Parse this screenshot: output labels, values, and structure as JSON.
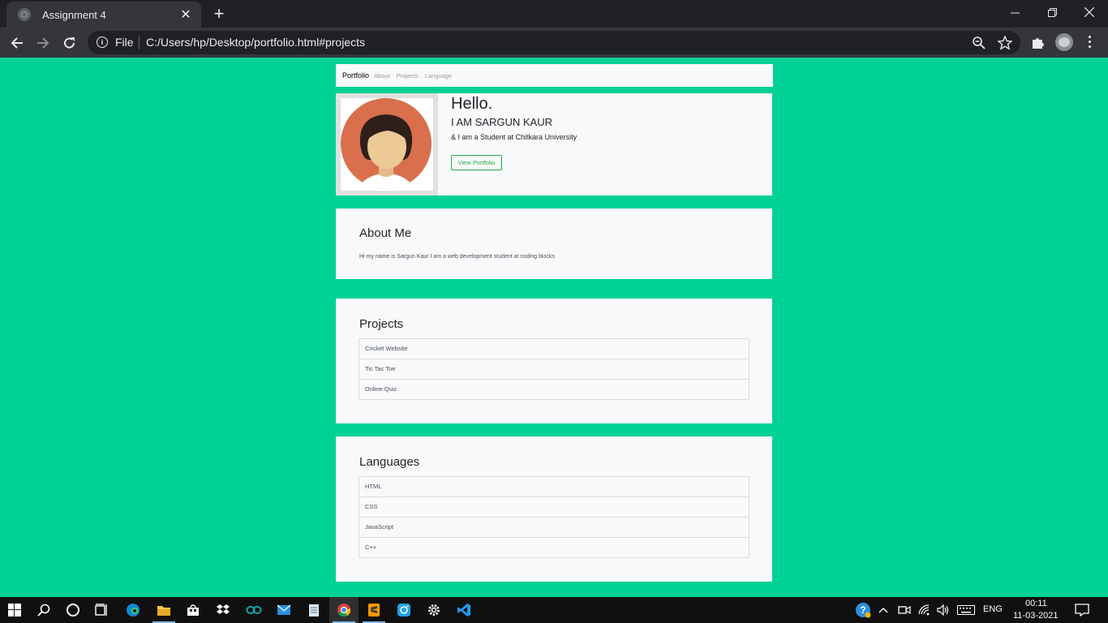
{
  "browser": {
    "tab_title": "Assignment 4",
    "tab_close": "✕",
    "new_tab": "+",
    "url_scheme": "File",
    "url": "C:/Users/hp/Desktop/portfolio.html#projects",
    "window_controls": {
      "minimize": "—",
      "restore": "❐",
      "close": "✕"
    }
  },
  "navbar": {
    "brand": "Portfolio",
    "links": [
      "About",
      "Projects",
      "Language"
    ]
  },
  "hero": {
    "title": "Hello.",
    "name": "I AM SARGUN KAUR",
    "subtitle": "& I am a Student at Chitkara University",
    "button": "View Portfolio"
  },
  "about": {
    "heading": "About Me",
    "text": "Hi my name is Sargun Kaur I am a web development student at coding blocks"
  },
  "projects": {
    "heading": "Projects",
    "items": [
      "Cricket Website",
      "Tic Tac Toe",
      "Online Quiz"
    ]
  },
  "languages": {
    "heading": "Languages",
    "items": [
      "HTML",
      "CSS",
      "JavaScript",
      "C++"
    ]
  },
  "taskbar": {
    "apps": [
      "windows-start-icon",
      "search-icon",
      "cortana-icon",
      "task-view-icon",
      "edge-icon",
      "file-explorer-icon",
      "store-icon",
      "dropbox-icon",
      "arduino-icon",
      "mail-icon",
      "notepad-icon",
      "chrome-icon",
      "sublime-icon",
      "instagram-icon",
      "settings-icon",
      "vscode-icon"
    ],
    "language": "ENG",
    "time": "00:11",
    "date": "11-03-2021"
  },
  "colors": {
    "page_background": "#00d194",
    "card_background": "#f8f9fa",
    "accent_green": "#28a745",
    "chrome_dark": "#202124"
  }
}
